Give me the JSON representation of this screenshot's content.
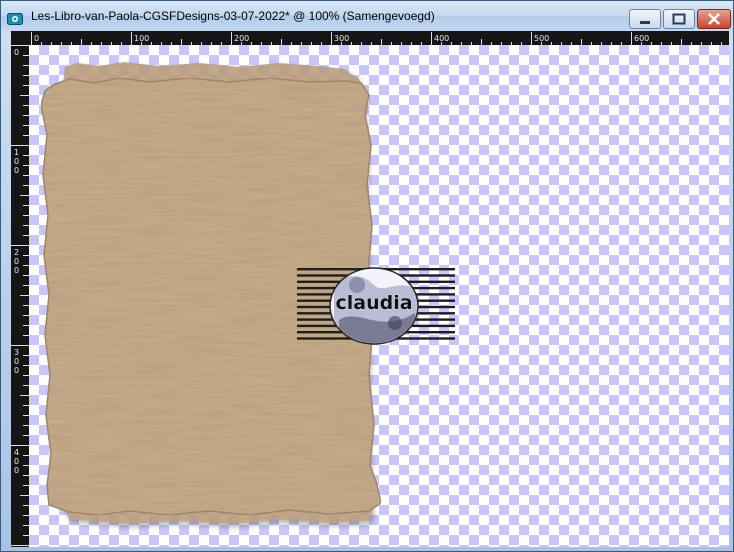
{
  "window": {
    "title": "Les-Libro-van-Paola-CGSFDesigns-03-07-2022* @ 100% (Samengevoegd)",
    "icon": "image-document-icon",
    "controls": [
      "minimize-icon",
      "maximize-icon",
      "close-icon"
    ]
  },
  "ruler": {
    "top_labels": [
      "0",
      "100",
      "200",
      "300",
      "400",
      "500",
      "600"
    ],
    "left_labels": [
      [
        "0"
      ],
      [
        "1",
        "0",
        "0"
      ],
      [
        "2",
        "0",
        "0"
      ],
      [
        "3",
        "0",
        "0"
      ],
      [
        "4",
        "0",
        "0"
      ]
    ]
  },
  "canvas": {
    "zoom": "100%",
    "watermark_text": "claudia"
  },
  "colors": {
    "paper": "#c9ad8a",
    "checker": "#c9c6fd",
    "ruler_bg": "#151515",
    "close_button": "#c7442b"
  }
}
